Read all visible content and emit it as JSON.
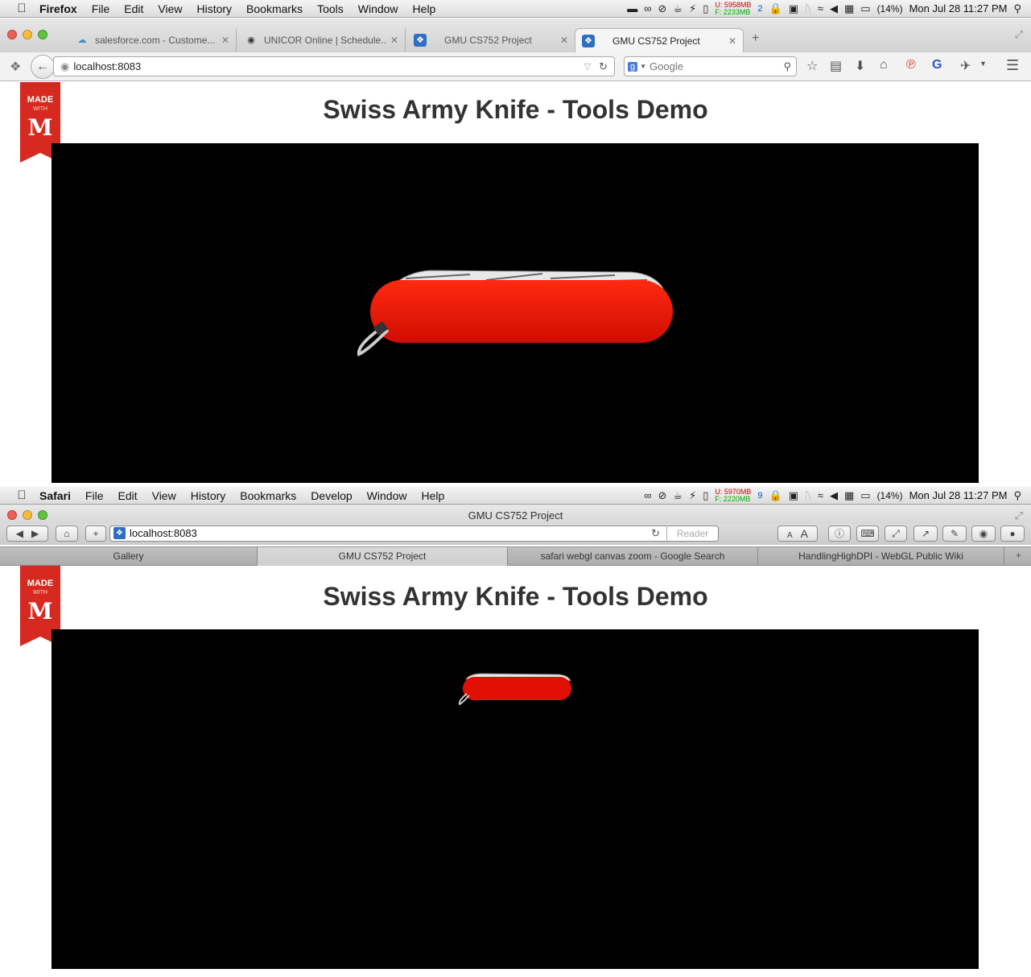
{
  "firefox": {
    "menubar": {
      "app": "Firefox",
      "items": [
        "File",
        "Edit",
        "View",
        "History",
        "Bookmarks",
        "Tools",
        "Window",
        "Help"
      ],
      "mem_u": "U: 5958MB",
      "mem_f": "F: 2233MB",
      "badge": "2",
      "battery": "(14%)",
      "clock": "Mon Jul 28  11:27 PM"
    },
    "tabs": [
      {
        "label": "salesforce.com - Custome..."
      },
      {
        "label": "UNICOR Online | Schedule..."
      },
      {
        "label": "GMU CS752 Project"
      },
      {
        "label": "GMU CS752 Project"
      }
    ],
    "url": "localhost:8083",
    "search_placeholder": "Google"
  },
  "safari": {
    "menubar": {
      "app": "Safari",
      "items": [
        "File",
        "Edit",
        "View",
        "History",
        "Bookmarks",
        "Develop",
        "Window",
        "Help"
      ],
      "mem_u": "U: 5970MB",
      "mem_f": "F: 2220MB",
      "badge": "9",
      "battery": "(14%)",
      "clock": "Mon Jul 28  11:27 PM"
    },
    "window_title": "GMU CS752 Project",
    "url": "localhost:8083",
    "reader_label": "Reader",
    "font_small": "A",
    "font_large": "A",
    "tabs": [
      {
        "label": "Gallery"
      },
      {
        "label": "GMU CS752 Project"
      },
      {
        "label": "safari webgl canvas zoom - Google Search"
      },
      {
        "label": "HandlingHighDPI - WebGL Public Wiki"
      }
    ]
  },
  "page": {
    "title": "Swiss Army Knife - Tools Demo",
    "ribbon_made": "MADE",
    "ribbon_with": "WITH",
    "ribbon_logo": "M"
  },
  "colors": {
    "knife_red": "#e01005",
    "canvas": "#000000",
    "ribbon": "#d62a20"
  }
}
